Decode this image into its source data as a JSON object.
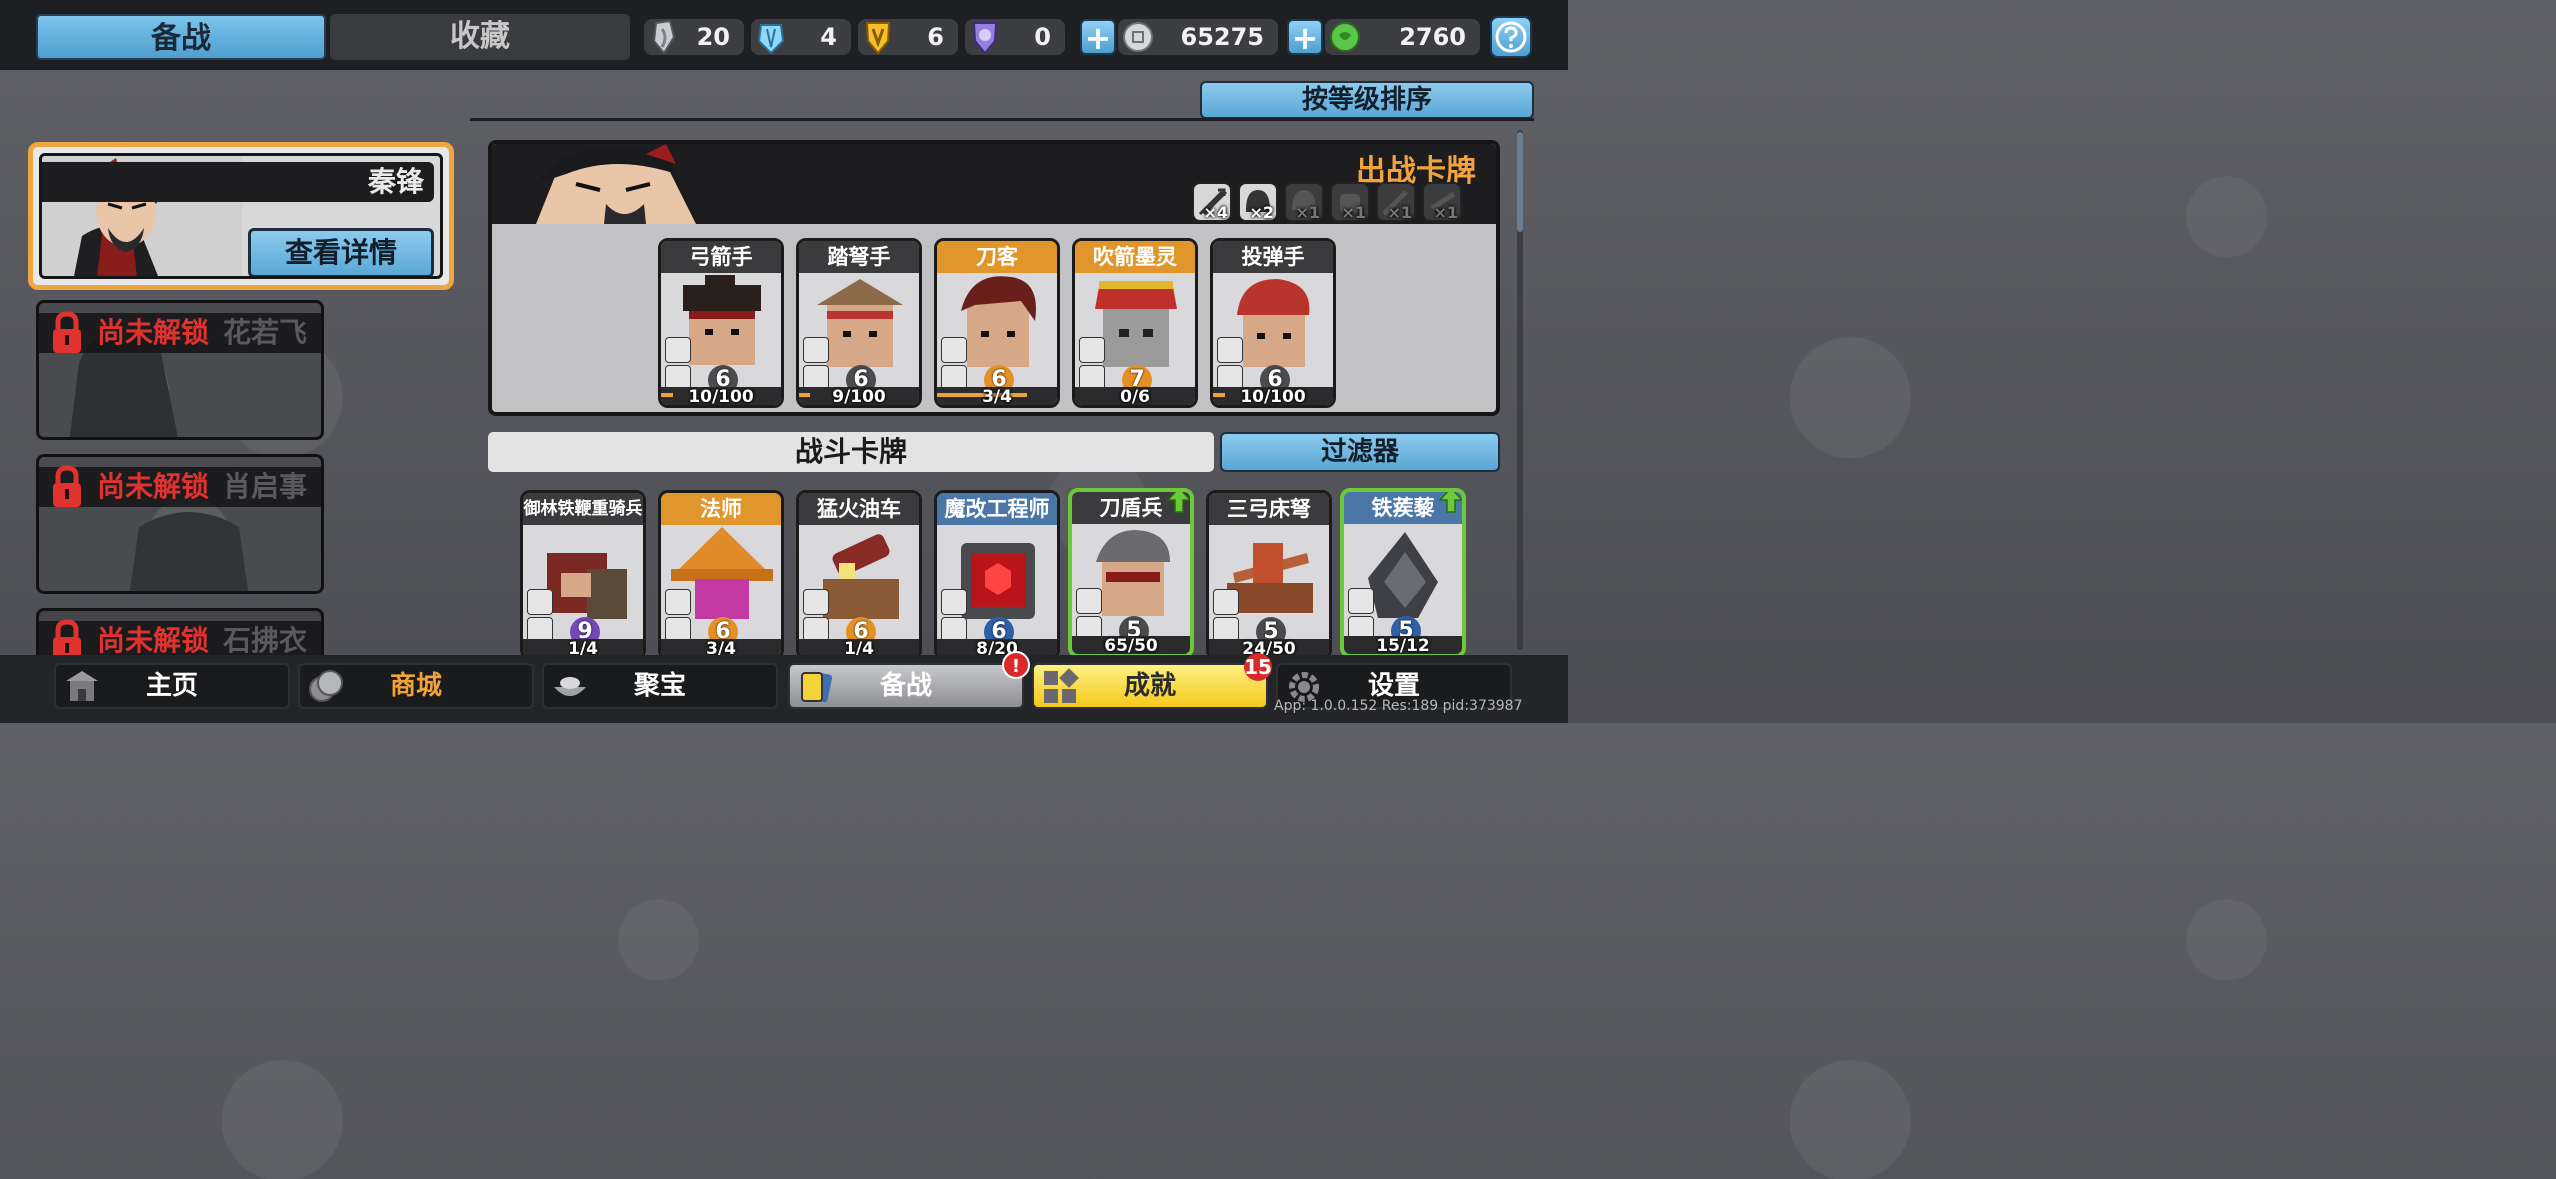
{
  "topbar": {
    "tabs": [
      {
        "label": "备战",
        "active": true
      },
      {
        "label": "收藏",
        "active": false
      }
    ],
    "resources": [
      {
        "icon": "silver-feather-icon",
        "value": "20"
      },
      {
        "icon": "blue-crystal-icon",
        "value": "4"
      },
      {
        "icon": "gold-trophy-icon",
        "value": "6"
      },
      {
        "icon": "purple-gem-icon",
        "value": "0"
      }
    ],
    "coins": {
      "icon": "silver-coin-icon",
      "value": "65275"
    },
    "jade": {
      "icon": "green-jade-icon",
      "value": "2760"
    },
    "help_icon": "question-icon"
  },
  "sort_button": "按等级排序",
  "heroes": {
    "selected": {
      "name": "秦锋",
      "detail_button": "查看详情"
    },
    "locked": [
      {
        "status": "尚未解锁",
        "name": "花若飞"
      },
      {
        "status": "尚未解锁",
        "name": "肖启事"
      },
      {
        "status": "尚未解锁",
        "name": "石拂衣"
      }
    ]
  },
  "deploy": {
    "title": "出战卡牌",
    "slots": [
      {
        "icon": "arrows-icon",
        "count": "×4",
        "active": true
      },
      {
        "icon": "helmet-icon",
        "count": "×2",
        "active": true
      },
      {
        "icon": "helmet-icon",
        "count": "×1",
        "active": false
      },
      {
        "icon": "fist-icon",
        "count": "×1",
        "active": false
      },
      {
        "icon": "sword-icon",
        "count": "×1",
        "active": false
      },
      {
        "icon": "dagger-icon",
        "count": "×1",
        "active": false
      }
    ],
    "cards": [
      {
        "name": "弓箭手",
        "level": "6",
        "progress": "10/100",
        "fill": 0.1,
        "style": "dark"
      },
      {
        "name": "踏弩手",
        "level": "6",
        "progress": "9/100",
        "fill": 0.09,
        "style": "dark"
      },
      {
        "name": "刀客",
        "level": "6",
        "progress": "3/4",
        "fill": 0.75,
        "style": "gold"
      },
      {
        "name": "吹箭墨灵",
        "level": "7",
        "progress": "0/6",
        "fill": 0.0,
        "style": "gold"
      },
      {
        "name": "投弹手",
        "level": "6",
        "progress": "10/100",
        "fill": 0.1,
        "style": "dark"
      }
    ]
  },
  "battle": {
    "title": "战斗卡牌",
    "filter_button": "过滤器",
    "cards": [
      {
        "name": "御林铁鞭重骑兵",
        "level": "9",
        "progress": "1/4",
        "style": "dark",
        "lvl_color": "purple"
      },
      {
        "name": "法师",
        "level": "6",
        "progress": "3/4",
        "style": "gold",
        "lvl_color": "orange"
      },
      {
        "name": "猛火油车",
        "level": "6",
        "progress": "1/4",
        "style": "dark",
        "lvl_color": "orange"
      },
      {
        "name": "魔改工程师",
        "level": "6",
        "progress": "8/20",
        "style": "blue",
        "lvl_color": "blue"
      },
      {
        "name": "刀盾兵",
        "level": "5",
        "progress": "65/50",
        "style": "dark",
        "lvl_color": "dark",
        "upgrade": true
      },
      {
        "name": "三弓床弩",
        "level": "5",
        "progress": "24/50",
        "style": "dark",
        "lvl_color": "dark"
      },
      {
        "name": "铁蒺藜",
        "level": "5",
        "progress": "15/12",
        "style": "blue",
        "lvl_color": "blue",
        "upgrade": true
      }
    ]
  },
  "nav": {
    "items": [
      {
        "label": "主页",
        "icon": "palace-icon"
      },
      {
        "label": "商城",
        "icon": "coins-icon"
      },
      {
        "label": "聚宝",
        "icon": "treasure-bowl-icon"
      },
      {
        "label": "备战",
        "icon": "cards-icon",
        "badge": "!"
      },
      {
        "label": "成就",
        "icon": "achievement-grid-icon",
        "badge": "15"
      },
      {
        "label": "设置",
        "icon": "gear-icon"
      }
    ]
  },
  "version": "App: 1.0.0.152 Res:189 pid:373987",
  "colors": {
    "accent_blue": "#5aa7d6",
    "gold": "#f0a640",
    "lock_red": "#e0322e",
    "upgrade_green": "#6ec93a"
  }
}
